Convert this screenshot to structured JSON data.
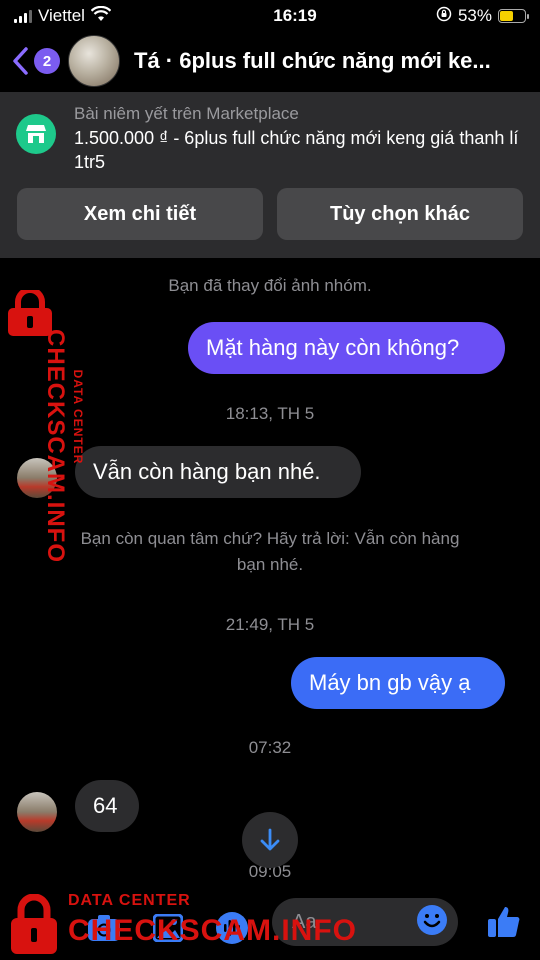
{
  "status": {
    "carrier": "Viettel",
    "time": "16:19",
    "battery": "53%",
    "battery_level": 0.53
  },
  "header": {
    "back_count": "2",
    "title": "Tá · 6plus full chức năng mới ke..."
  },
  "marketplace": {
    "label": "Bài niêm yết trên Marketplace",
    "description": "1.500.000 ₫ - 6plus full chức năng mới keng giá thanh lí 1tr5",
    "view_details": "Xem chi tiết",
    "more_options": "Tùy chọn khác"
  },
  "messages": {
    "changed_photo": "Bạn đã thay đổi ảnh nhóm.",
    "m1": "Mặt hàng này còn không?",
    "t1": "18:13, TH 5",
    "m2": "Vẫn còn hàng bạn nhé.",
    "prompt": "Bạn còn quan tâm chứ? Hãy trả lời: Vẫn còn hàng bạn nhé.",
    "t2": "21:49, TH 5",
    "m3": "Máy bn gb vậy ạ",
    "t3": "07:32",
    "m4": "64",
    "t4": "09:05"
  },
  "composer": {
    "placeholder": "Aa"
  },
  "watermark": {
    "small": "DATA CENTER",
    "big": "CHECKSCAM.INFO"
  }
}
